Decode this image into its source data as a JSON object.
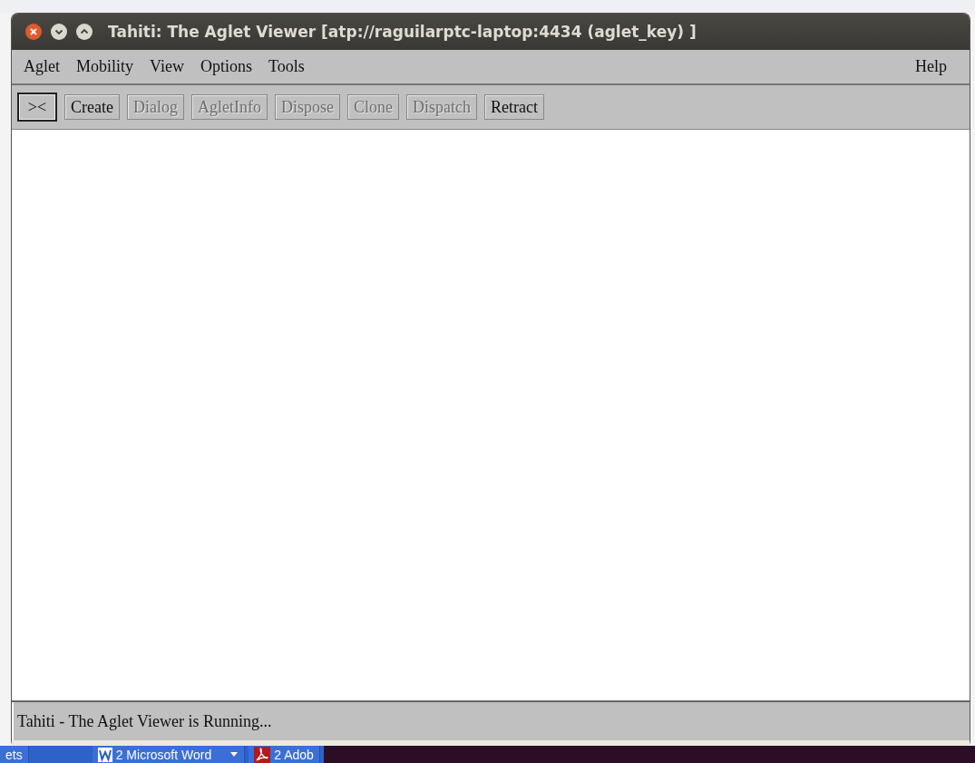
{
  "window": {
    "title": "Tahiti: The Aglet Viewer [atp://raguilarptc-laptop:4434 (aglet_key) ]"
  },
  "menu": [
    {
      "label": "Aglet"
    },
    {
      "label": "Mobility"
    },
    {
      "label": "View"
    },
    {
      "label": "Options"
    },
    {
      "label": "Tools"
    }
  ],
  "help_menu": {
    "label": "Help"
  },
  "toolbar": [
    {
      "label": "><",
      "disabled": false,
      "selected": true
    },
    {
      "label": "Create",
      "disabled": false,
      "selected": false
    },
    {
      "label": "Dialog",
      "disabled": true,
      "selected": false
    },
    {
      "label": "AgletInfo",
      "disabled": true,
      "selected": false
    },
    {
      "label": "Dispose",
      "disabled": true,
      "selected": false
    },
    {
      "label": "Clone",
      "disabled": true,
      "selected": false
    },
    {
      "label": "Dispatch",
      "disabled": true,
      "selected": false
    },
    {
      "label": "Retract",
      "disabled": false,
      "selected": false
    }
  ],
  "status_bar": "Tahiti - The Aglet Viewer is Running...",
  "taskbar": [
    {
      "label": "ets",
      "kind": "plain"
    },
    {
      "label": "2 Microsoft Word",
      "kind": "word"
    },
    {
      "label": "2 Adob",
      "kind": "pdf"
    }
  ]
}
